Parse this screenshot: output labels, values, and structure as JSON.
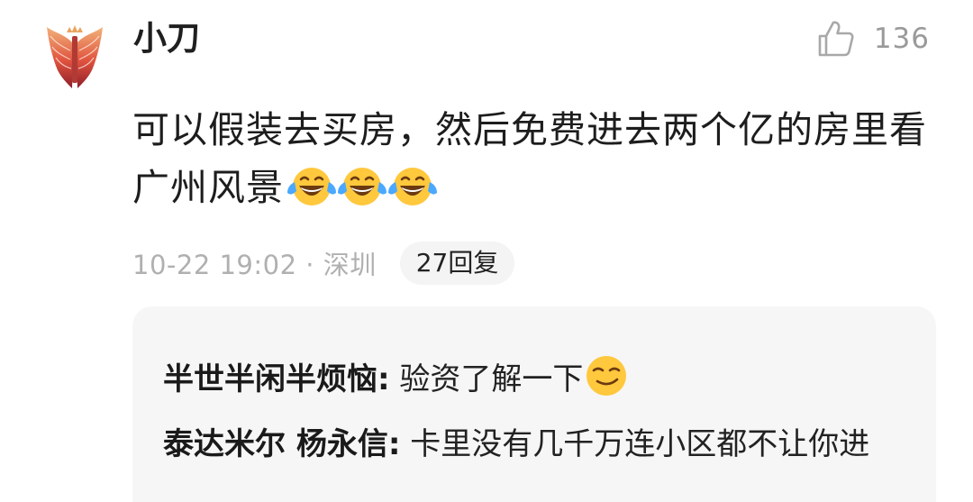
{
  "comment": {
    "username": "小刀",
    "likes": "136",
    "text": "可以假装去买房，然后免费进去两个亿的房里看广州风景",
    "emojis": [
      "laugh-cry-emoji",
      "laugh-cry-emoji",
      "laugh-cry-emoji"
    ],
    "meta": "10-22 19:02 · 深圳",
    "reply_count_label": "27回复"
  },
  "replies": [
    {
      "author": "半世半闲半烦恼",
      "separator": ":",
      "text": " 验资了解一下",
      "emoji": "smirk-emoji"
    },
    {
      "author": "泰达米尔 杨永信",
      "separator": ":",
      "text": " 卡里没有几千万连小区都不让你进"
    }
  ],
  "colors": {
    "meta_gray": "#b0b0b0",
    "reply_bg": "#f6f6f6",
    "emoji_yellow": "#ffc83d",
    "tear_blue": "#4aa8ff"
  }
}
